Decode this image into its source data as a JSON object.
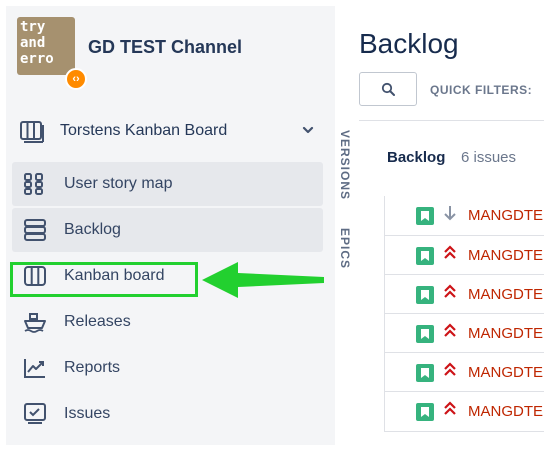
{
  "project": {
    "avatar_text": "try\nand\nerro",
    "badge_icon": "code-icon",
    "name": "GD TEST Channel"
  },
  "board_selector": {
    "icon": "board-icon",
    "label": "Torstens Kanban Board",
    "chevron": "chevron-down-icon"
  },
  "nav": {
    "items": [
      {
        "label": "User story map",
        "icon": "grid-dots-icon",
        "selected": true
      },
      {
        "label": "Backlog",
        "icon": "backlog-icon",
        "selected": true
      },
      {
        "label": "Kanban board",
        "icon": "kanban-board-icon",
        "selected": false
      },
      {
        "label": "Releases",
        "icon": "ship-icon",
        "selected": false
      },
      {
        "label": "Reports",
        "icon": "chart-line-icon",
        "selected": false
      },
      {
        "label": "Issues",
        "icon": "issues-icon",
        "selected": false
      }
    ]
  },
  "side_tabs": {
    "versions": "VERSIONS",
    "epics": "EPICS"
  },
  "page": {
    "title": "Backlog",
    "quick_filters_label": "QUICK FILTERS:"
  },
  "backlog": {
    "title": "Backlog",
    "count": "6 issues",
    "issues": [
      {
        "key": "MANGDTE",
        "type": "story-icon",
        "priority": "low"
      },
      {
        "key": "MANGDTE",
        "type": "story-icon",
        "priority": "highest"
      },
      {
        "key": "MANGDTE",
        "type": "story-icon",
        "priority": "highest"
      },
      {
        "key": "MANGDTE",
        "type": "story-icon",
        "priority": "highest"
      },
      {
        "key": "MANGDTE",
        "type": "story-icon",
        "priority": "highest"
      },
      {
        "key": "MANGDTE",
        "type": "story-icon",
        "priority": "highest"
      }
    ]
  },
  "colors": {
    "annotation": "#22d02f",
    "story": "#36b37e",
    "priority_high": "#cd1317",
    "priority_low": "#8993a4",
    "issue_key": "#bf2600"
  }
}
